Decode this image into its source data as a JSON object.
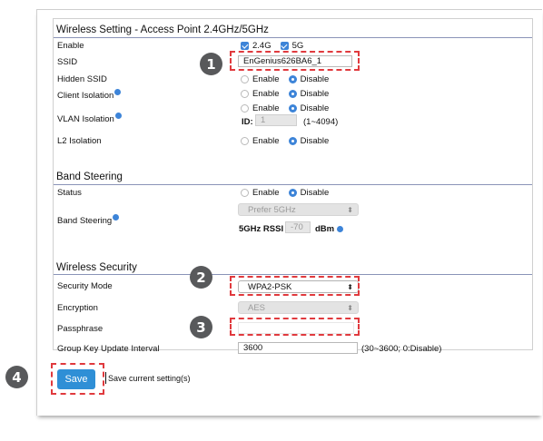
{
  "wireless_setting": {
    "title": "Wireless Setting - Access Point 2.4GHz/5GHz",
    "enable": {
      "label": "Enable",
      "opt_24": "2.4G",
      "opt_5": "5G"
    },
    "ssid": {
      "label": "SSID",
      "value": "EnGenius626BA6_1"
    },
    "hidden_ssid": {
      "label": "Hidden SSID",
      "enable": "Enable",
      "disable": "Disable"
    },
    "client_isolation": {
      "label": "Client Isolation",
      "enable": "Enable",
      "disable": "Disable"
    },
    "vlan_isolation": {
      "label": "VLAN Isolation",
      "enable": "Enable",
      "disable": "Disable",
      "id_label": "ID:",
      "id_value": "1",
      "id_range": "(1~4094)"
    },
    "l2_isolation": {
      "label": "L2 Isolation",
      "enable": "Enable",
      "disable": "Disable"
    }
  },
  "band_steering": {
    "title": "Band Steering",
    "status": {
      "label": "Status",
      "enable": "Enable",
      "disable": "Disable"
    },
    "band_steering": {
      "label": "Band Steering",
      "select_value": "Prefer 5GHz",
      "rssi_label": "5GHz RSSI",
      "rssi_value": "-70",
      "rssi_unit": "dBm"
    }
  },
  "wireless_security": {
    "title": "Wireless Security",
    "security_mode": {
      "label": "Security Mode",
      "value": "WPA2-PSK"
    },
    "encryption": {
      "label": "Encryption",
      "value": "AES"
    },
    "passphrase": {
      "label": "Passphrase",
      "value": ""
    },
    "group_key": {
      "label": "Group Key Update Interval",
      "value": "3600",
      "hint": "(30~3600; 0:Disable)"
    }
  },
  "actions": {
    "save_label": "Save",
    "save_note": "Save current setting(s)"
  },
  "steps": [
    "1",
    "2",
    "3",
    "4"
  ],
  "colors": {
    "accent": "#3d84d8",
    "button": "#2f8fd6",
    "callout": "#e03a3e",
    "step_badge": "#58595b",
    "divider": "#8a93b8"
  }
}
